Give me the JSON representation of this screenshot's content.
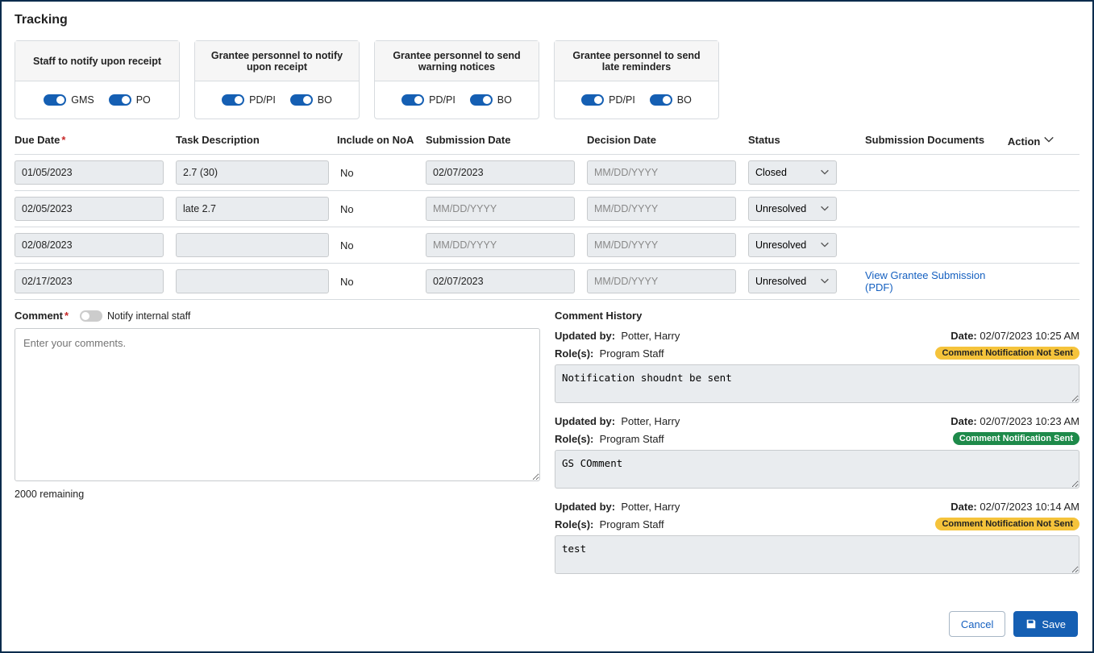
{
  "title": "Tracking",
  "cards": [
    {
      "title": "Staff to notify upon receipt",
      "toggles": [
        {
          "label": "GMS",
          "on": true
        },
        {
          "label": "PO",
          "on": true
        }
      ]
    },
    {
      "title": "Grantee personnel to notify upon receipt",
      "toggles": [
        {
          "label": "PD/PI",
          "on": true
        },
        {
          "label": "BO",
          "on": true
        }
      ]
    },
    {
      "title": "Grantee personnel to send warning notices",
      "toggles": [
        {
          "label": "PD/PI",
          "on": true
        },
        {
          "label": "BO",
          "on": true
        }
      ]
    },
    {
      "title": "Grantee personnel to send late reminders",
      "toggles": [
        {
          "label": "PD/PI",
          "on": true
        },
        {
          "label": "BO",
          "on": true
        }
      ]
    }
  ],
  "columns": {
    "due": "Due Date",
    "task": "Task Description",
    "noa": "Include on NoA",
    "sub": "Submission Date",
    "dec": "Decision Date",
    "status": "Status",
    "docs": "Submission Documents",
    "action": "Action"
  },
  "date_placeholder": "MM/DD/YYYY",
  "rows": [
    {
      "due": "01/05/2023",
      "task": "2.7 (30)",
      "noa": "No",
      "sub": "02/07/2023",
      "dec": "",
      "status": "Closed",
      "docs": ""
    },
    {
      "due": "02/05/2023",
      "task": "late 2.7",
      "noa": "No",
      "sub": "",
      "dec": "",
      "status": "Unresolved",
      "docs": ""
    },
    {
      "due": "02/08/2023",
      "task": "",
      "noa": "No",
      "sub": "",
      "dec": "",
      "status": "Unresolved",
      "docs": ""
    },
    {
      "due": "02/17/2023",
      "task": "",
      "noa": "No",
      "sub": "02/07/2023",
      "dec": "",
      "status": "Unresolved",
      "docs": "View Grantee Submission (PDF)"
    }
  ],
  "comment": {
    "label": "Comment",
    "notify_label": "Notify internal staff",
    "placeholder": "Enter your comments.",
    "remaining": "2000 remaining"
  },
  "history": {
    "label": "Comment History",
    "updated_by_label": "Updated by:",
    "role_label": "Role(s):",
    "date_label": "Date:",
    "items": [
      {
        "by": "Potter, Harry",
        "date": "02/07/2023 10:25 AM",
        "role": "Program Staff",
        "badge": "Comment Notification Not Sent",
        "badge_class": "badge-notsent",
        "text": "Notification shoudnt be sent"
      },
      {
        "by": "Potter, Harry",
        "date": "02/07/2023 10:23 AM",
        "role": "Program Staff",
        "badge": "Comment Notification Sent",
        "badge_class": "badge-sent",
        "text": "GS COmment"
      },
      {
        "by": "Potter, Harry",
        "date": "02/07/2023 10:14 AM",
        "role": "Program Staff",
        "badge": "Comment Notification Not Sent",
        "badge_class": "badge-notsent",
        "text": "test"
      }
    ]
  },
  "buttons": {
    "cancel": "Cancel",
    "save": "Save"
  }
}
